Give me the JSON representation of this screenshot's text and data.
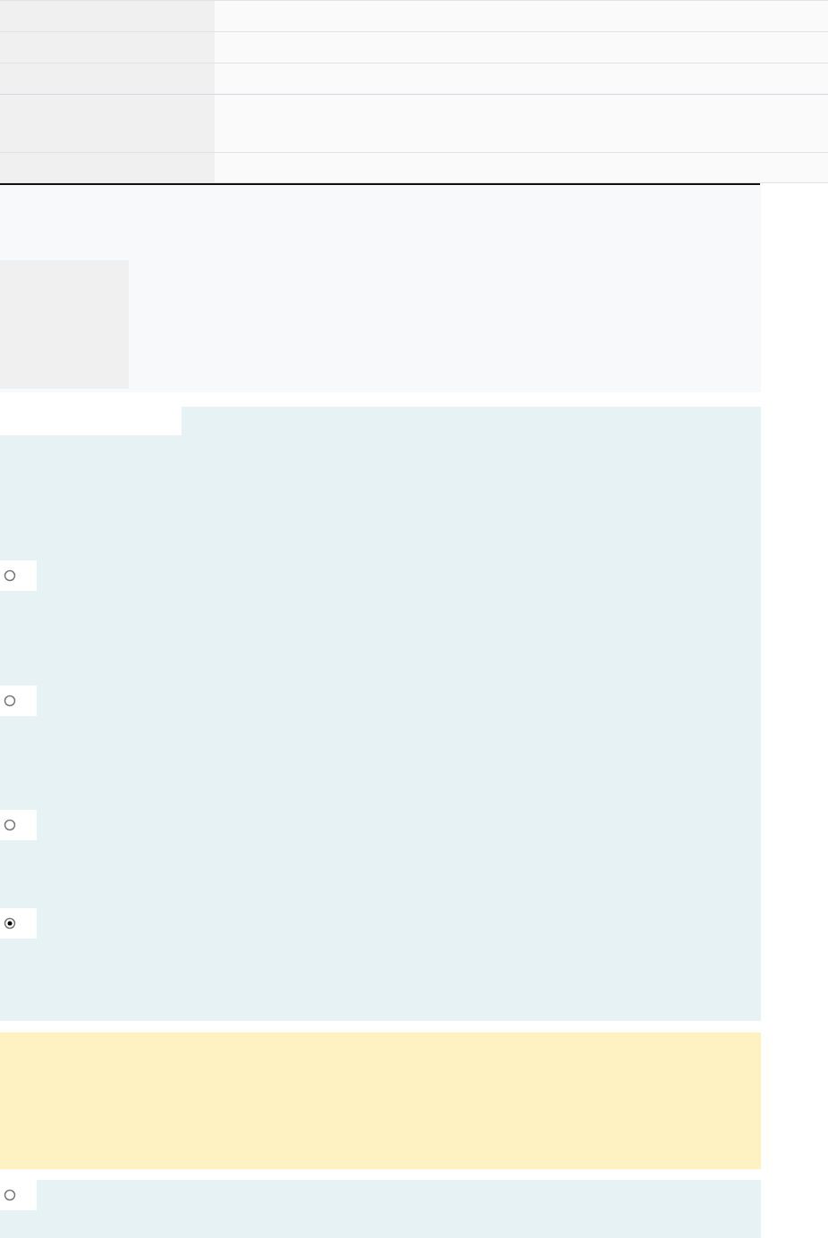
{
  "options": [
    {
      "selected": false
    },
    {
      "selected": false
    },
    {
      "selected": false
    },
    {
      "selected": true
    }
  ],
  "extra_option": {
    "selected": false
  }
}
